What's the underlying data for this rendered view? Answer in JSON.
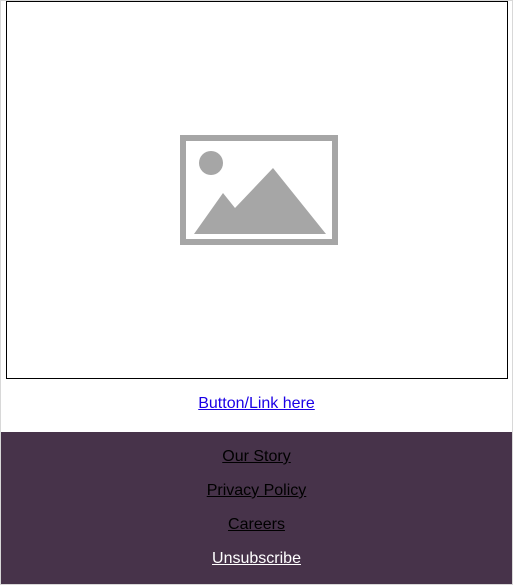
{
  "hero": {
    "image_icon": "image-placeholder-icon"
  },
  "cta": {
    "label": "Button/Link here",
    "color": "#1a00e6"
  },
  "footer": {
    "background": "#47334a",
    "links": [
      {
        "label": "Our Story",
        "color": "#000000"
      },
      {
        "label": "Privacy Policy",
        "color": "#000000"
      },
      {
        "label": "Careers",
        "color": "#000000"
      },
      {
        "label": "Unsubscribe",
        "color": "#ffffff"
      }
    ]
  }
}
